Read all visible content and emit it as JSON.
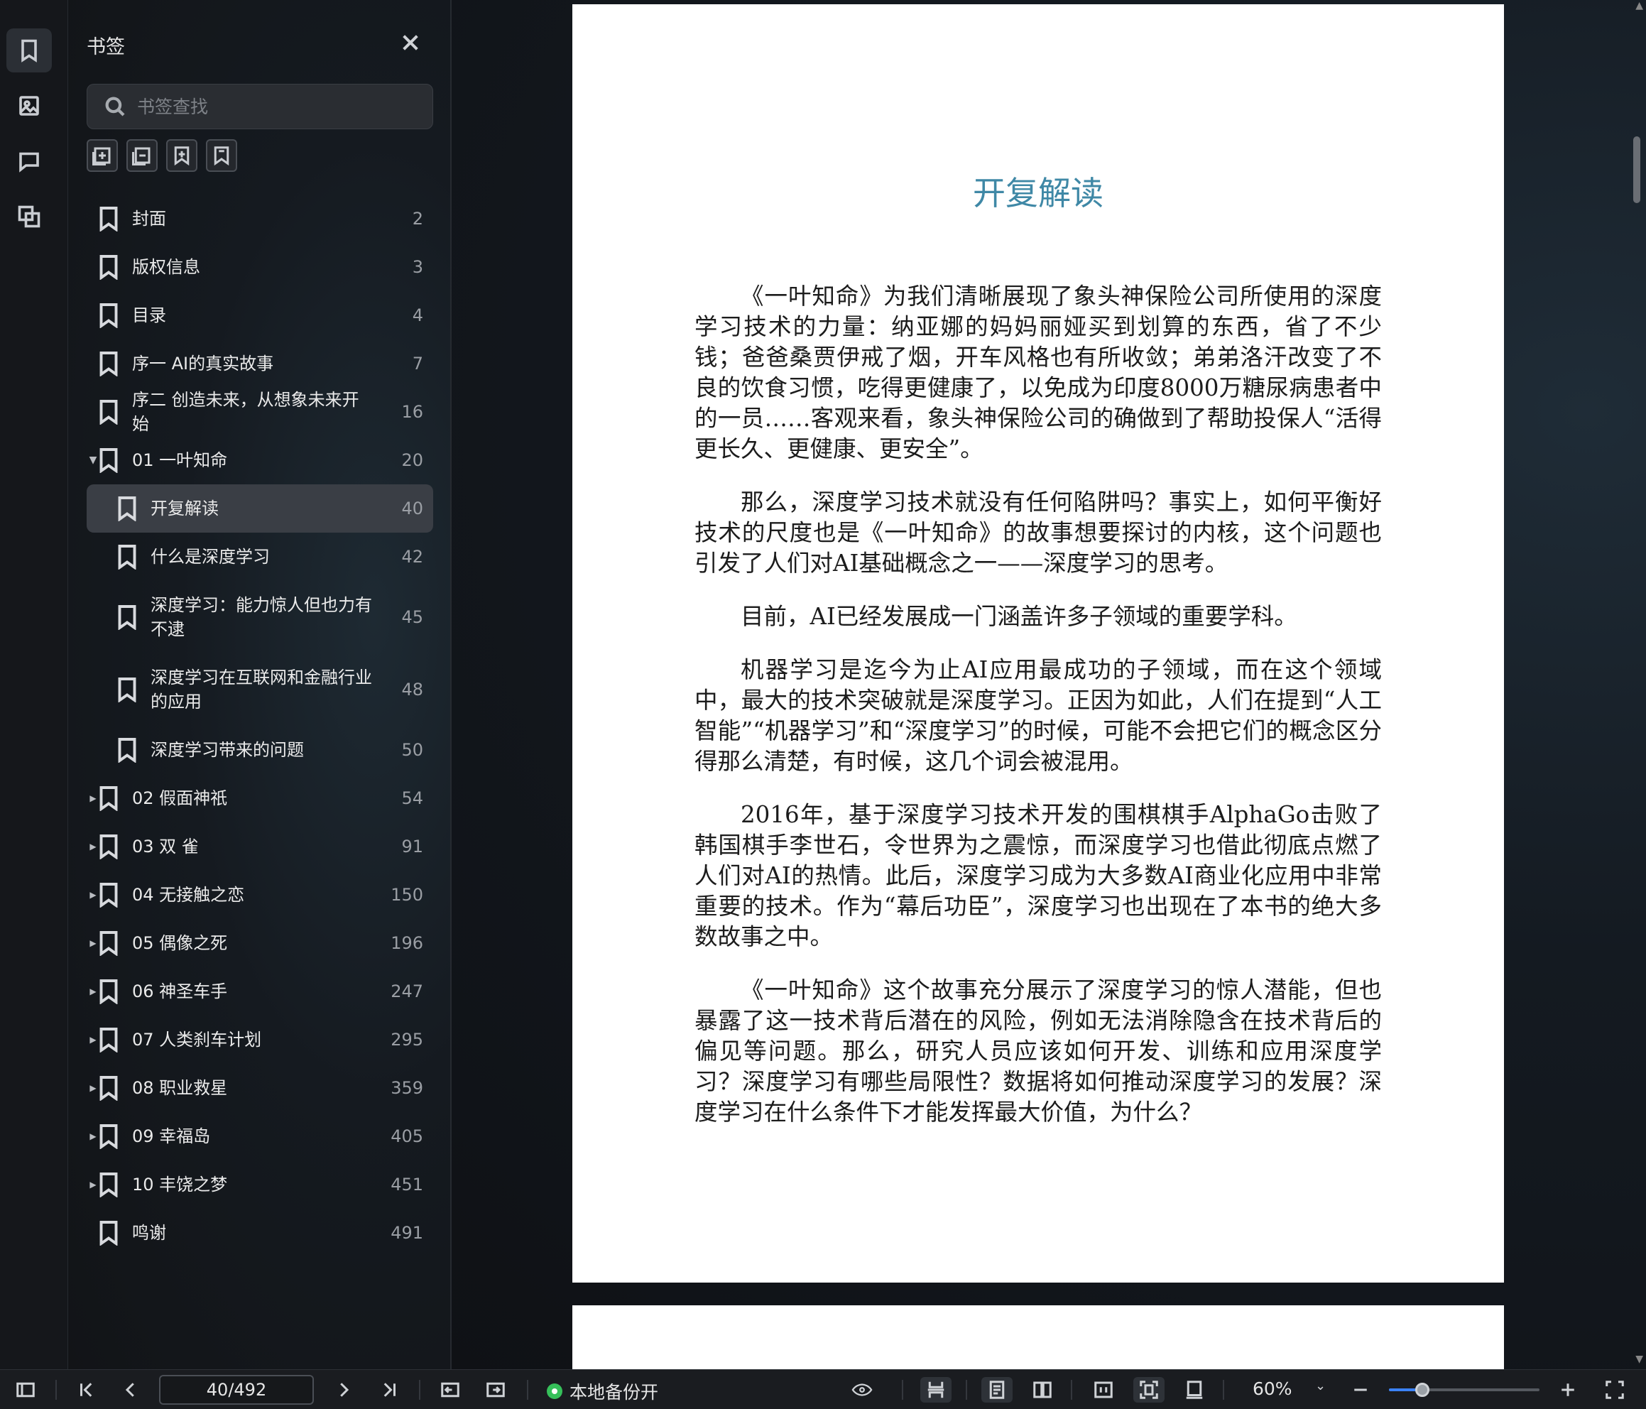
{
  "sidebar_rail": {
    "items": [
      {
        "name": "bookmark-tab-icon",
        "active": true
      },
      {
        "name": "image-tab-icon",
        "active": false
      },
      {
        "name": "comment-tab-icon",
        "active": false
      },
      {
        "name": "thumbnail-tab-icon",
        "active": false
      }
    ]
  },
  "panel": {
    "title": "书签",
    "search_placeholder": "书签查找",
    "tools": [
      "add-bookmark-icon",
      "add-child-bookmark-icon",
      "insert-bookmark-icon",
      "bookmark-outline-icon"
    ],
    "bookmarks": [
      {
        "label": "封面",
        "page": "2",
        "level": 0,
        "expander": ""
      },
      {
        "label": "版权信息",
        "page": "3",
        "level": 0,
        "expander": ""
      },
      {
        "label": "目录",
        "page": "4",
        "level": 0,
        "expander": ""
      },
      {
        "label": "序一 AI的真实故事",
        "page": "7",
        "level": 0,
        "expander": ""
      },
      {
        "label": "序二 创造未来，从想象未来开始",
        "page": "16",
        "level": 0,
        "expander": ""
      },
      {
        "label": "01 一叶知命",
        "page": "20",
        "level": 0,
        "expander": "▼"
      },
      {
        "label": "开复解读",
        "page": "40",
        "level": 1,
        "expander": "",
        "selected": true
      },
      {
        "label": "什么是深度学习",
        "page": "42",
        "level": 1,
        "expander": ""
      },
      {
        "label": "深度学习：能力惊人但也力有不逮",
        "page": "45",
        "level": 1,
        "expander": "",
        "tall": true
      },
      {
        "label": "深度学习在互联网和金融行业的应用",
        "page": "48",
        "level": 1,
        "expander": "",
        "tall": true
      },
      {
        "label": "深度学习带来的问题",
        "page": "50",
        "level": 1,
        "expander": ""
      },
      {
        "label": "02 假面神祇",
        "page": "54",
        "level": 0,
        "expander": "▶"
      },
      {
        "label": "03 双 雀",
        "page": "91",
        "level": 0,
        "expander": "▶"
      },
      {
        "label": "04 无接触之恋",
        "page": "150",
        "level": 0,
        "expander": "▶"
      },
      {
        "label": "05 偶像之死",
        "page": "196",
        "level": 0,
        "expander": "▶"
      },
      {
        "label": "06 神圣车手",
        "page": "247",
        "level": 0,
        "expander": "▶"
      },
      {
        "label": "07 人类刹车计划",
        "page": "295",
        "level": 0,
        "expander": "▶"
      },
      {
        "label": "08 职业救星",
        "page": "359",
        "level": 0,
        "expander": "▶"
      },
      {
        "label": "09 幸福岛",
        "page": "405",
        "level": 0,
        "expander": "▶"
      },
      {
        "label": "10 丰饶之梦",
        "page": "451",
        "level": 0,
        "expander": "▶"
      },
      {
        "label": "鸣谢",
        "page": "491",
        "level": 0,
        "expander": ""
      }
    ]
  },
  "document": {
    "chapter_title": "开复解读",
    "paragraphs": [
      "《一叶知命》为我们清晰展现了象头神保险公司所使用的深度学习技术的力量：纳亚娜的妈妈丽娅买到划算的东西，省了不少钱；爸爸桑贾伊戒了烟，开车风格也有所收敛；弟弟洛汗改变了不良的饮食习惯，吃得更健康了，以免成为印度8000万糖尿病患者中的一员……客观来看，象头神保险公司的确做到了帮助投保人“活得更长久、更健康、更安全”。",
      "那么，深度学习技术就没有任何陷阱吗？事实上，如何平衡好技术的尺度也是《一叶知命》的故事想要探讨的内核，这个问题也引发了人们对AI基础概念之一——深度学习的思考。",
      "目前，AI已经发展成一门涵盖许多子领域的重要学科。",
      "机器学习是迄今为止AI应用最成功的子领域，而在这个领域中，最大的技术突破就是深度学习。正因为如此，人们在提到“人工智能”“机器学习”和“深度学习”的时候，可能不会把它们的概念区分得那么清楚，有时候，这几个词会被混用。",
      "2016年，基于深度学习技术开发的围棋棋手AlphaGo击败了韩国棋手李世石，令世界为之震惊，而深度学习也借此彻底点燃了人们对AI的热情。此后，深度学习成为大多数AI商业化应用中非常重要的技术。作为“幕后功臣”，深度学习也出现在了本书的绝大多数故事之中。",
      "《一叶知命》这个故事充分展示了深度学习的惊人潜能，但也暴露了这一技术背后潜在的风险，例如无法消除隐含在技术背后的偏见等问题。那么，研究人员应该如何开发、训练和应用深度学习？深度学习有哪些局限性？数据将如何推动深度学习的发展？深度学习在什么条件下才能发挥最大价值，为什么？"
    ]
  },
  "toolbar": {
    "page_indicator": "40/492",
    "backup_label": "本地备份开",
    "zoom_label": "60%",
    "zoom_fraction": 0.22,
    "accent_color": "#3b82f6",
    "status_color": "#36c05a"
  }
}
